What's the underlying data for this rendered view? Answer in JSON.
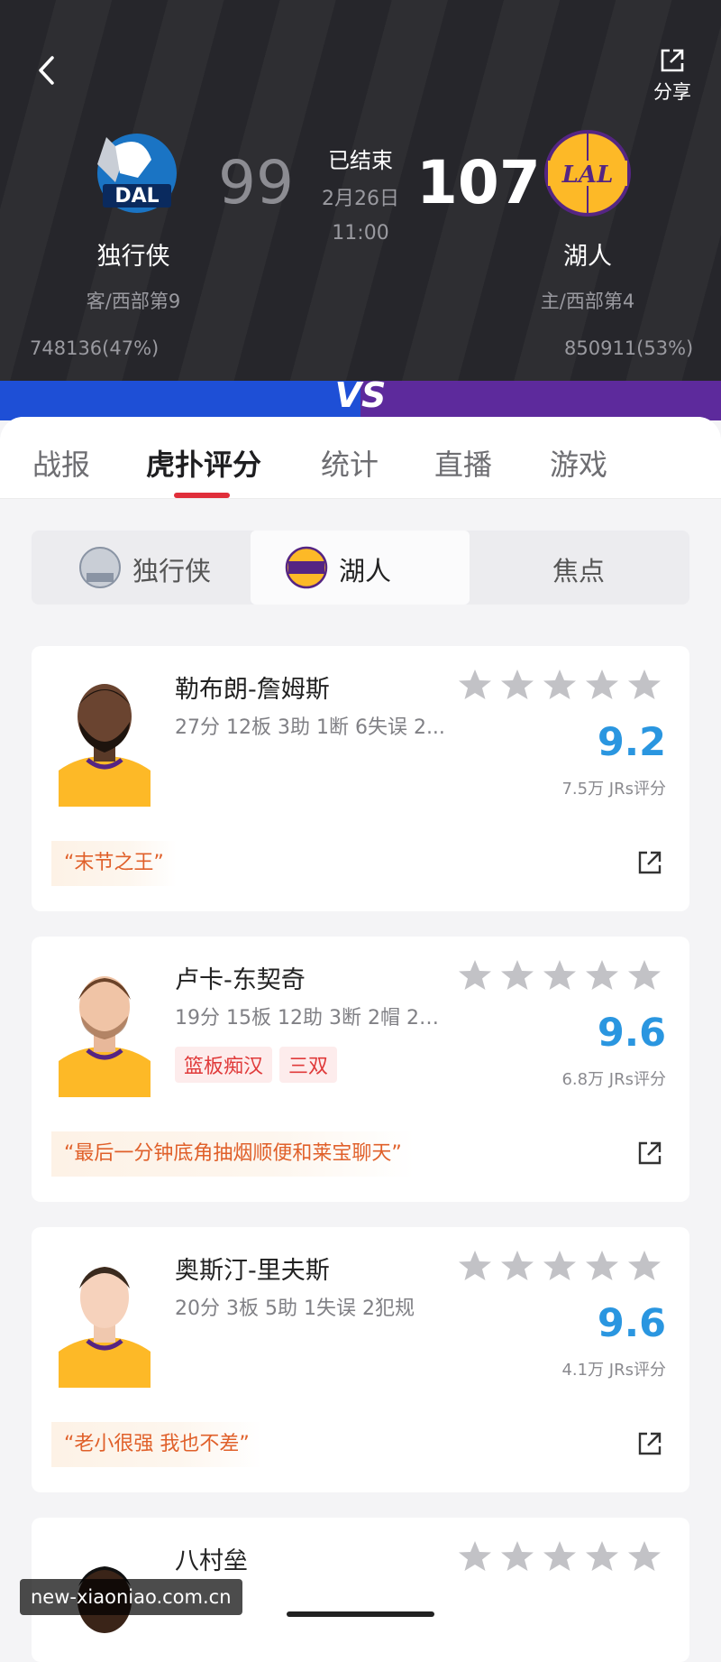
{
  "header": {
    "share_label": "分享",
    "status": "已结束",
    "date": "2月26日",
    "time": "11:00",
    "away": {
      "name": "独行侠",
      "score": "99",
      "rank": "客/西部第9",
      "votes": "748136(47%)",
      "logo_text": "DAL"
    },
    "home": {
      "name": "湖人",
      "score": "107",
      "rank": "主/西部第4",
      "votes": "850911(53%)",
      "logo_text": "LAL"
    },
    "vs_mark": "VS"
  },
  "tabs": [
    "战报",
    "虎扑评分",
    "统计",
    "直播",
    "游戏"
  ],
  "active_tab": "虎扑评分",
  "segment": [
    "独行侠",
    "湖人",
    "焦点"
  ],
  "active_segment": "湖人",
  "players": [
    {
      "name": "勒布朗-詹姆斯",
      "stats": "27分 12板 3助 1断 6失误 2...",
      "rating": "9.2",
      "count": "7.5万 JRs评分",
      "tags": [],
      "quote": "“末节之王”"
    },
    {
      "name": "卢卡-东契奇",
      "stats": "19分 15板 12助 3断 2帽 2失...",
      "rating": "9.6",
      "count": "6.8万 JRs评分",
      "tags": [
        "篮板痴汉",
        "三双"
      ],
      "quote": "“最后一分钟底角抽烟顺便和莱宝聊天”"
    },
    {
      "name": "奥斯汀-里夫斯",
      "stats": "20分 3板 5助 1失误 2犯规",
      "rating": "9.6",
      "count": "4.1万 JRs评分",
      "tags": [],
      "quote": "“老小很强 我也不差”"
    },
    {
      "name": "八村垒"
    }
  ],
  "watermark": "new-xiaoniao.com.cn",
  "colors": {
    "accent_red": "#e02e3a",
    "rating_blue": "#2a96e0",
    "quote_orange": "#e0602a",
    "header_bg": "#26262b"
  }
}
